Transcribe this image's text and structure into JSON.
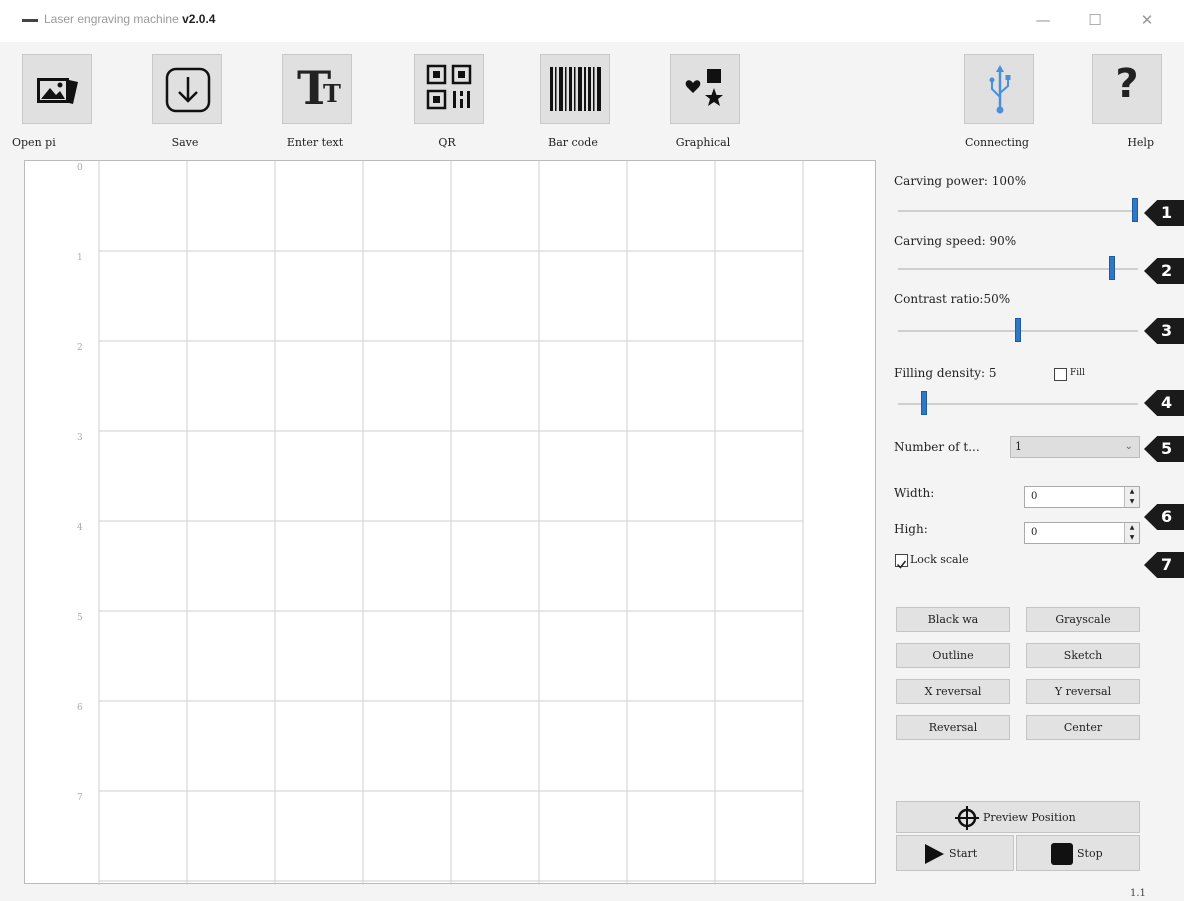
{
  "window": {
    "title": "Laser engraving machine",
    "version": "v2.0.4",
    "minimize": "—",
    "maximize": "☐",
    "close": "✕"
  },
  "toolbar": {
    "items": [
      {
        "label": "Open pi",
        "icon": "open-picture-icon"
      },
      {
        "label": "Save",
        "icon": "save-download-icon"
      },
      {
        "label": "Enter text",
        "icon": "text-icon"
      },
      {
        "label": "QR",
        "icon": "qr-code-icon"
      },
      {
        "label": "Bar code",
        "icon": "barcode-icon"
      },
      {
        "label": "Graphical",
        "icon": "shapes-icon"
      },
      {
        "label": "Connecting",
        "icon": "usb-icon"
      },
      {
        "label": "Help",
        "icon": "help-icon"
      }
    ],
    "text_glyph": "T",
    "text_glyph_small": "T",
    "help_glyph": "?"
  },
  "canvas": {
    "ruler_numbers": [
      "0",
      "1",
      "2",
      "3",
      "4",
      "5",
      "6",
      "7"
    ]
  },
  "controls": {
    "carving_power": {
      "label": "Carving power: 100%",
      "value": 100,
      "marker": "1"
    },
    "carving_speed": {
      "label": "Carving speed: 90%",
      "value": 90,
      "marker": "2"
    },
    "contrast_ratio": {
      "label": "Contrast ratio:50%",
      "value": 50,
      "marker": "3"
    },
    "filling_density": {
      "label": "Filling density: 5",
      "value": 5,
      "marker": "4",
      "fill_label": "Fill",
      "fill_checked": false
    },
    "number_of_times": {
      "label": "Number of t...",
      "value": "1",
      "marker": "5"
    },
    "width": {
      "label": "Width:",
      "value": "0"
    },
    "height": {
      "label": "High:",
      "value": "0"
    },
    "size_marker": "6",
    "lock_scale": {
      "label": "Lock scale",
      "checked": true,
      "marker": "7"
    }
  },
  "buttons": {
    "black_white": "Black wa",
    "grayscale": "Grayscale",
    "outline": "Outline",
    "sketch": "Sketch",
    "x_reversal": "X reversal",
    "y_reversal": "Y reversal",
    "reversal": "Reversal",
    "center": "Center",
    "preview_position": "Preview Position",
    "start": "Start",
    "stop": "Stop"
  },
  "status_corner": "1.1",
  "colors": {
    "slider_thumb": "#2f78c8",
    "marker": "#1a1a1a",
    "background": "#f4f4f4"
  }
}
